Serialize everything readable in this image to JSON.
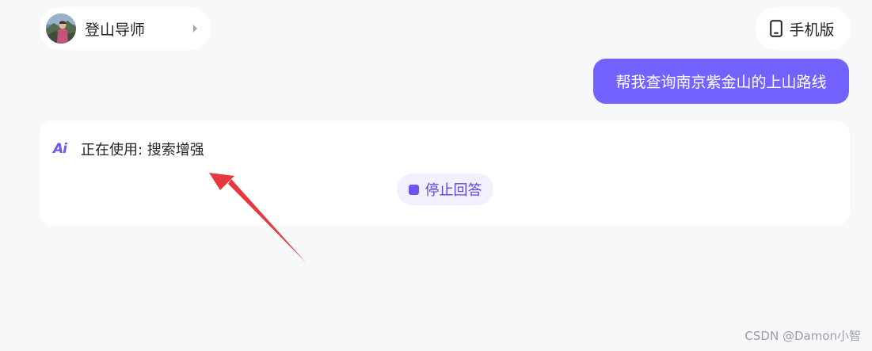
{
  "header": {
    "assistant": {
      "name": "登山导师",
      "avatar_icon": "avatar-climber"
    },
    "mobile_button": {
      "label": "手机版",
      "icon": "phone-icon"
    }
  },
  "conversation": {
    "user_message": "帮我查询南京紫金山的上山路线",
    "ai_response": {
      "icon_text": "Ai",
      "status_text": "正在使用: 搜索增强",
      "stop_button_label": "停止回答"
    }
  },
  "watermark": "CSDN @Damon小智",
  "colors": {
    "accent": "#7362ff",
    "page_background": "#f7f8fa",
    "card_background": "#ffffff",
    "stop_button_background": "#f2f0fe",
    "annotation_arrow": "#e8383d"
  }
}
